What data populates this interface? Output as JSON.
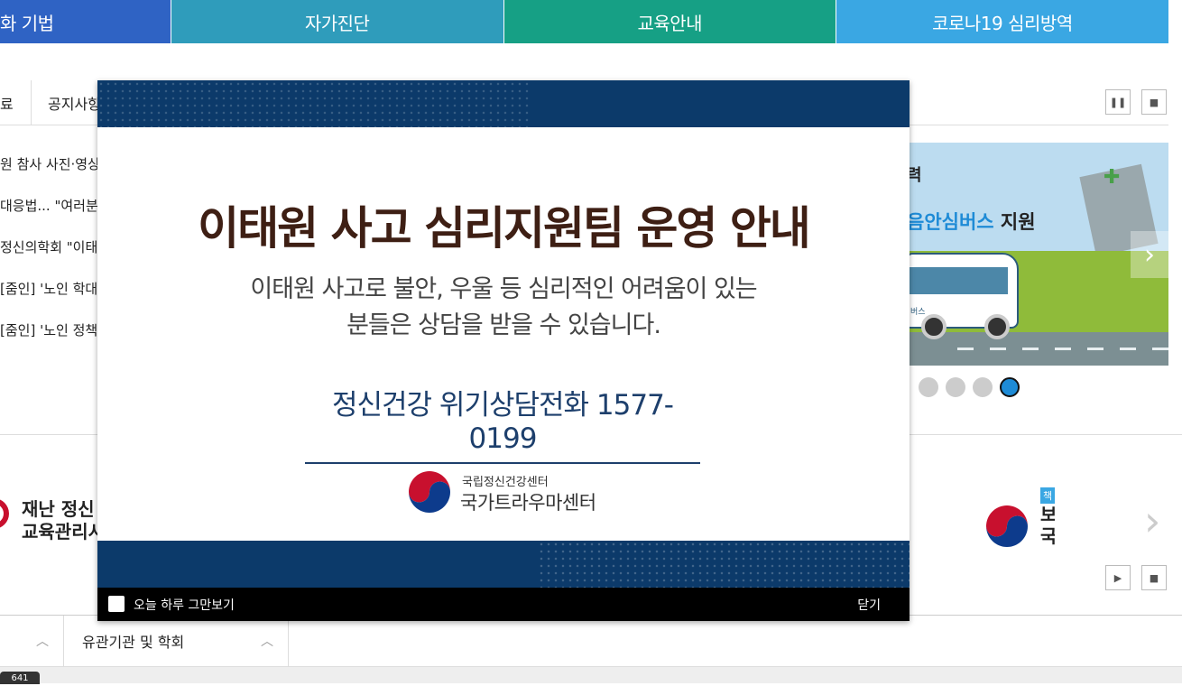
{
  "nav": {
    "items": [
      "화 기법",
      "자가진단",
      "교육안내",
      "코로나19 심리방역"
    ]
  },
  "board": {
    "tabs": [
      "료",
      "공지사항"
    ],
    "items": [
      "원 참사 사진·영상",
      "대응법... \"여러분",
      "정신의학회 \"이태",
      "[줌인] '노인 학대",
      "[줌인] '노인 정책"
    ]
  },
  "banner": {
    "line1": "력",
    "line2_highlight": "음안심버스",
    "line2_rest": " 지원",
    "bus_label": "버스"
  },
  "partners": {
    "left_lines": [
      "재난 정신",
      "교육관리시"
    ],
    "right_badge": "책",
    "right_lines": [
      "보",
      "국"
    ]
  },
  "footer": {
    "links": [
      "",
      "유관기관 및 학회"
    ],
    "page_badge": "641"
  },
  "popup": {
    "title": "이태원 사고 심리지원팀 운영 안내",
    "desc_line1": "이태원 사고로 불안, 우울 등 심리적인 어려움이 있는",
    "desc_line2": "분들은 상담을 받을 수 있습니다.",
    "phone": "정신건강 위기상담전화 1577-0199",
    "org_sub": "국립정신건강센터",
    "org_name": "국가트라우마센터",
    "dont_show_today": "오늘 하루 그만보기",
    "close": "닫기"
  },
  "icons": {
    "pause": "pause-icon",
    "stop": "stop-icon",
    "play": "play-icon",
    "chevron_up": "chevron-up-icon",
    "chevron_right": "chevron-right-icon"
  }
}
